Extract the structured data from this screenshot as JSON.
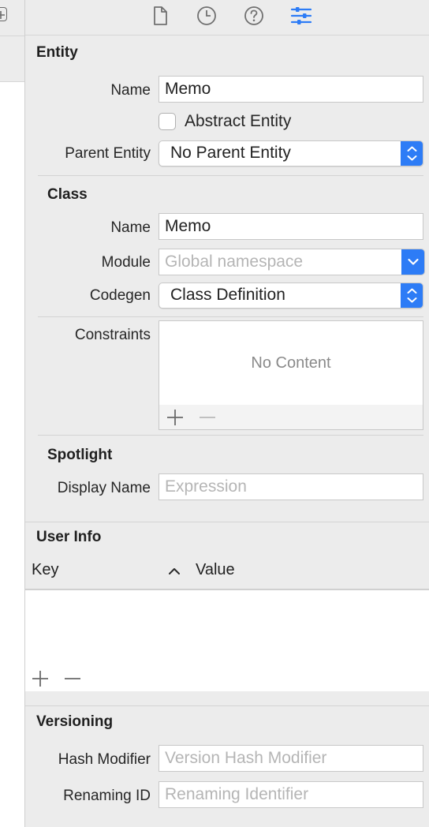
{
  "toolbar": {
    "icons": [
      "file-inspector-icon",
      "history-inspector-icon",
      "quick-help-icon",
      "data-model-inspector-icon"
    ],
    "accent": "#2d7cf6"
  },
  "entity": {
    "section_title": "Entity",
    "name_label": "Name",
    "name_value": "Memo",
    "abstract_label": "Abstract Entity",
    "abstract_checked": false,
    "parent_label": "Parent Entity",
    "parent_value": "No Parent Entity"
  },
  "class": {
    "section_title": "Class",
    "name_label": "Name",
    "name_value": "Memo",
    "module_label": "Module",
    "module_placeholder": "Global namespace",
    "codegen_label": "Codegen",
    "codegen_value": "Class Definition"
  },
  "constraints": {
    "label": "Constraints",
    "empty_text": "No Content",
    "add_symbol": "+",
    "remove_symbol": "−"
  },
  "spotlight": {
    "section_title": "Spotlight",
    "display_name_label": "Display Name",
    "display_name_placeholder": "Expression"
  },
  "user_info": {
    "section_title": "User Info",
    "columns": [
      "Key",
      "Value"
    ],
    "sort_indicator": "^",
    "rows": [],
    "add_symbol": "+",
    "remove_symbol": "−"
  },
  "versioning": {
    "section_title": "Versioning",
    "hash_label": "Hash Modifier",
    "hash_placeholder": "Version Hash Modifier",
    "renaming_label": "Renaming ID",
    "renaming_placeholder": "Renaming Identifier"
  }
}
